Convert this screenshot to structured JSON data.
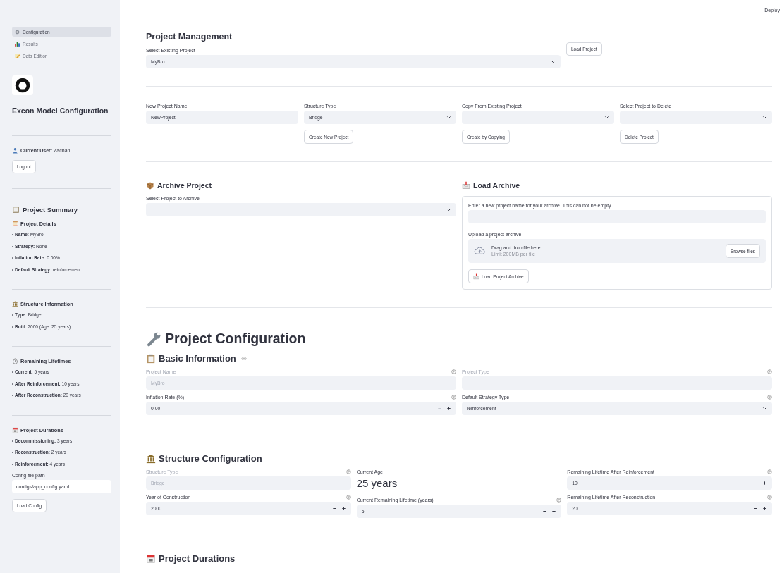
{
  "sidebar": {
    "nav": [
      {
        "label": "Configuration",
        "selected": true
      },
      {
        "label": "Results",
        "selected": false
      },
      {
        "label": "Data Edition",
        "selected": false
      }
    ],
    "app_title": "Excon Model Configuration",
    "current_user": "**Current User:** Zachari",
    "logout_button": "Logout",
    "summary_title": "Project Summary",
    "groups": [
      {
        "title": "Project Details",
        "items": [
          "• **Name:** MyBro",
          "• **Strategy:** None",
          "• **Inflation Rate:** 0.00%",
          "• **Default Strategy:** reinforcement"
        ]
      },
      {
        "title": "Structure Information",
        "items": [
          "• **Type:** Bridge",
          "• **Built:** 2000 (Age: 25 years)"
        ]
      },
      {
        "title": "Remaining Lifetimes",
        "items": [
          "• **Current:** 5 years",
          "• **After Reinforcement:** 10 years",
          "• **After Reconstruction:** 20 years"
        ]
      },
      {
        "title": "Project Durations",
        "items": [
          "• **Decommissioning:** 3 years",
          "• **Reconstruction:** 2 years",
          "• **Reinforcement:** 4 years"
        ]
      }
    ],
    "config_path": {
      "label": "Config file path",
      "value": "configs/app_config.yaml"
    },
    "load_config_button": "Load Config"
  },
  "deploy": "Deploy",
  "project_management": {
    "title": "Project Management",
    "select_existing": {
      "label": "Select Existing Project",
      "value": "MyBro"
    },
    "load_button": "Load Project",
    "columns": [
      {
        "label": "New Project Name",
        "kind": "text",
        "value": "NewProject"
      },
      {
        "label": "Structure Type",
        "kind": "select",
        "value": "Bridge",
        "button": "Create New Project"
      },
      {
        "label": "Copy From Existing Project",
        "kind": "select",
        "button": "Create by Copying"
      },
      {
        "label": "Select Project to Delete",
        "kind": "select",
        "button": "Delete Project"
      }
    ]
  },
  "archive": {
    "title": "Archive Project",
    "select_label": "Select Project to Archive"
  },
  "load_archive": {
    "title": "Load Archive",
    "name_label": "Enter a new project name for your archive. This can not be empty",
    "upload_label": "Upload a project archive",
    "drop_text": "Drag and drop file here",
    "limit": "Limit 200MB per file",
    "browse_button": "Browse files",
    "load_button": "Load Project Archive"
  },
  "configuration": {
    "title": "Project Configuration",
    "sections": [
      {
        "title": "Basic Information",
        "fields": [
          {
            "label": "Project Name",
            "kind": "text",
            "value": "MyBro",
            "disabled": true,
            "help": true
          },
          {
            "label": "Project Type",
            "kind": "text",
            "disabled": true,
            "help": true
          },
          {
            "label": "Inflation Rate (%)",
            "kind": "number",
            "value": "0.00",
            "disabled": false,
            "help": true,
            "minus_disabled": true
          },
          {
            "label": "Default Strategy Type",
            "kind": "select",
            "value": "reinforcement",
            "disabled": false,
            "help": true
          }
        ]
      },
      {
        "title": "Structure Configuration",
        "fields": [
          {
            "label": "Structure Type",
            "kind": "text",
            "value": "Bridge",
            "disabled": true,
            "help": true
          },
          {
            "label": "Year of Construction",
            "kind": "number",
            "value": "2000",
            "disabled": false,
            "help": true,
            "minus_disabled": false
          },
          {
            "label": "Current Age",
            "kind": "metric",
            "value": "25 years",
            "disabled": false,
            "help": false
          },
          {
            "label": "Current Remaining Lifetime (years)",
            "kind": "number",
            "value": "5",
            "disabled": false,
            "help": true,
            "minus_disabled": false
          },
          {
            "label": "Remaining Lifetime After Reinforcement",
            "kind": "number",
            "value": "10",
            "disabled": false,
            "help": true,
            "minus_disabled": false
          },
          {
            "label": "Remaining Lifetime After Reconstruction",
            "kind": "number",
            "value": "20",
            "disabled": false,
            "help": true,
            "minus_disabled": false
          }
        ]
      }
    ],
    "next_section_title": "Project Durations"
  }
}
